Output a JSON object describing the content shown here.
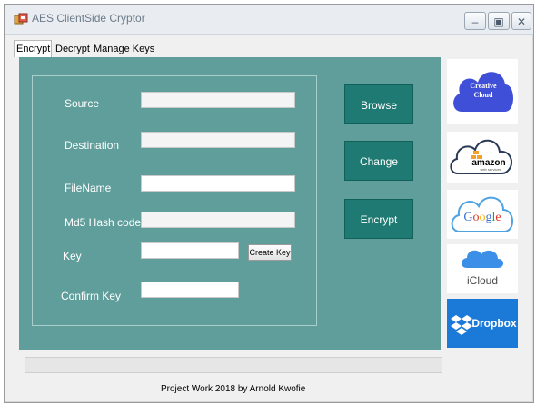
{
  "window": {
    "title": "AES ClientSide Cryptor",
    "controls": [
      "minimize-icon",
      "maximize-icon",
      "close-icon"
    ]
  },
  "tabs": [
    {
      "label": "Encrypt",
      "active": true
    },
    {
      "label": "Decrypt",
      "active": false
    },
    {
      "label": "Manage Keys",
      "active": false
    }
  ],
  "form": {
    "source_label": "Source",
    "source_value": "",
    "destination_label": "Destination",
    "destination_value": "",
    "filename_label": "FileName",
    "filename_value": "",
    "md5_label": "Md5 Hash code",
    "md5_value": "",
    "key_label": "Key",
    "key_value": "",
    "create_key_label": "Create Key",
    "confirm_key_label": "Confirm Key",
    "confirm_key_value": ""
  },
  "actions": {
    "browse_label": "Browse",
    "change_label": "Change",
    "encrypt_label": "Encrypt"
  },
  "cloud_services": {
    "creative_cloud": "Creative Cloud",
    "amazon": "amazon",
    "amazon_sub": "web services",
    "google": "Google",
    "icloud": "iCloud",
    "dropbox": "Dropbox"
  },
  "footer": {
    "text": "Project Work 2018 by Arnold Kwofie"
  },
  "colors": {
    "panel": "#5f9e9b",
    "action_button": "#1f7a73",
    "dropbox": "#1b7ad8"
  }
}
